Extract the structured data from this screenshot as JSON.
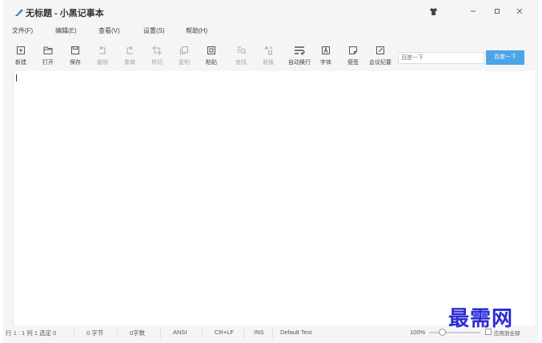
{
  "window": {
    "title": "无标题 - 小黑记事本"
  },
  "menu": [
    "文件(F)",
    "编辑(E)",
    "查看(V)",
    "设置(S)",
    "帮助(H)"
  ],
  "toolbar": [
    {
      "label": "新建",
      "icon": "new-file-icon",
      "enabled": true
    },
    {
      "label": "打开",
      "icon": "folder-open-icon",
      "enabled": true
    },
    {
      "label": "保存",
      "icon": "save-icon",
      "enabled": true
    },
    {
      "label": "撤销",
      "icon": "undo-icon",
      "enabled": false
    },
    {
      "label": "重做",
      "icon": "redo-icon",
      "enabled": false
    },
    {
      "label": "剪切",
      "icon": "cut-icon",
      "enabled": false
    },
    {
      "label": "复制",
      "icon": "copy-icon",
      "enabled": false
    },
    {
      "label": "粘贴",
      "icon": "paste-icon",
      "enabled": true
    },
    {
      "label": "查找",
      "icon": "find-icon",
      "enabled": false
    },
    {
      "label": "替换",
      "icon": "replace-icon",
      "enabled": false
    },
    {
      "label": "自动换行",
      "icon": "word-wrap-icon",
      "enabled": true
    },
    {
      "label": "字体",
      "icon": "font-icon",
      "enabled": true
    },
    {
      "label": "便签",
      "icon": "sticky-note-icon",
      "enabled": true
    },
    {
      "label": "会议纪要",
      "icon": "meeting-notes-icon",
      "enabled": true
    }
  ],
  "search": {
    "placeholder": "百度一下",
    "button_label": "百度一下"
  },
  "status": {
    "position": "行 1 : 1  列 1  选定 0",
    "bytes": "0 字节",
    "chars": "0字数",
    "encoding": "ANSI",
    "line_ending": "CR+LF",
    "insert_mode": "INS",
    "text_type": "Default Text",
    "zoom": "100%",
    "apply_all": "应用到全部"
  },
  "watermark": "最需网",
  "colors": {
    "accent": "#4aa4e6",
    "watermark": "#2b2bd6",
    "background": "#f5f5f5"
  }
}
